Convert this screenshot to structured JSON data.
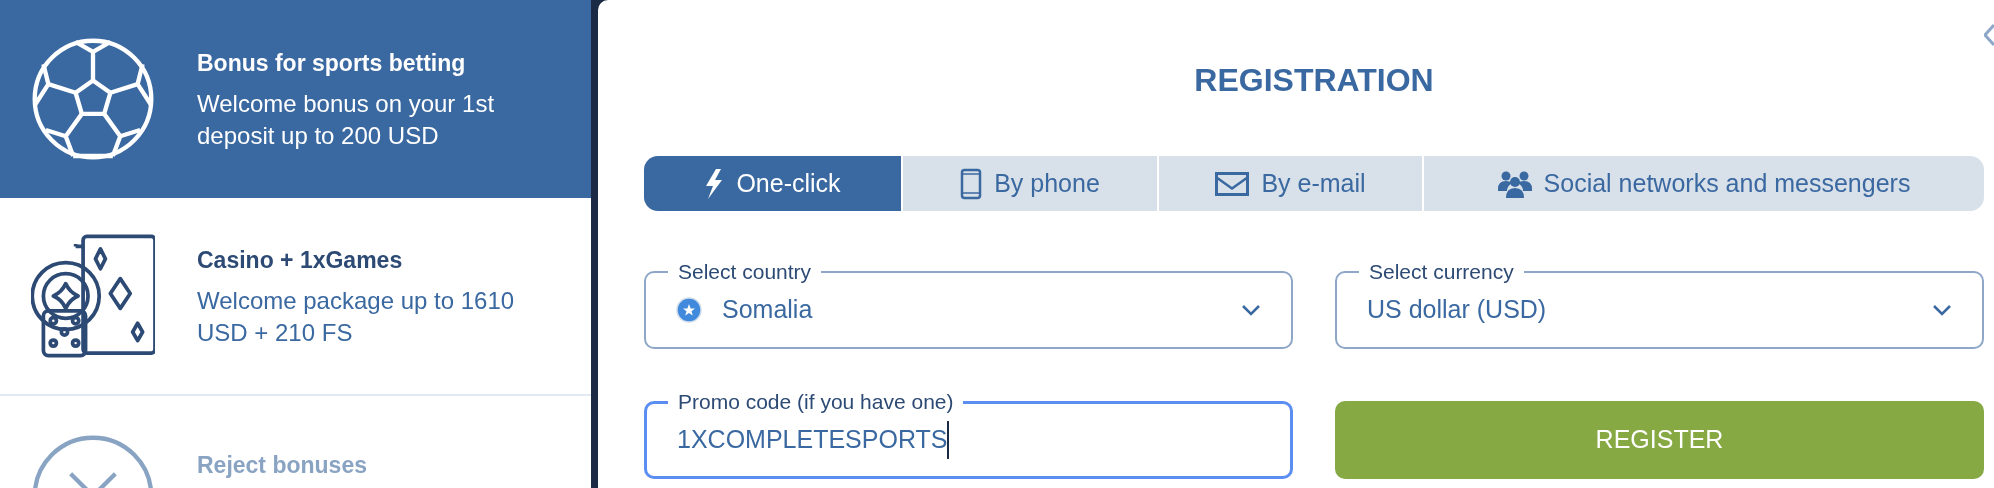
{
  "bonuses": [
    {
      "title": "Bonus for sports betting",
      "description": "Welcome bonus on your 1st deposit up to 200 USD",
      "selected": true,
      "disabled": false
    },
    {
      "title": "Casino + 1xGames",
      "description": "Welcome package up to 1610 USD + 210 FS",
      "selected": false,
      "disabled": false
    },
    {
      "title": "Reject bonuses",
      "selected": false,
      "disabled": true
    }
  ],
  "registration": {
    "title": "REGISTRATION",
    "tabs": [
      {
        "label": "One-click",
        "selected": true
      },
      {
        "label": "By phone",
        "selected": false
      },
      {
        "label": "By e-mail",
        "selected": false
      },
      {
        "label": "Social networks and messengers",
        "selected": false
      }
    ],
    "country": {
      "label": "Select country",
      "value": "Somalia"
    },
    "currency": {
      "label": "Select currency",
      "value": "US dollar (USD)"
    },
    "promo": {
      "label": "Promo code (if you have one)",
      "value": "1XCOMPLETESPORTS",
      "focused": true
    },
    "submit": "REGISTER"
  }
}
